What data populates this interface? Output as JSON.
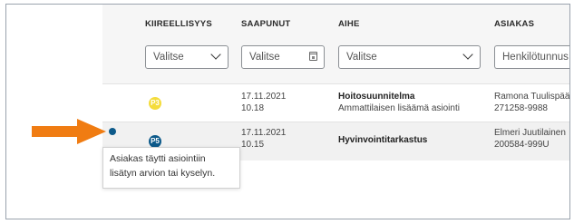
{
  "table": {
    "columns": [
      {
        "key": "urgency",
        "label": "KIIREELLISYYS"
      },
      {
        "key": "arrived",
        "label": "SAAPUNUT"
      },
      {
        "key": "subject",
        "label": "AIHE"
      },
      {
        "key": "customer",
        "label": "ASIAKAS"
      }
    ],
    "filters": {
      "urgency_placeholder": "Valitse",
      "arrived_placeholder": "Valitse",
      "subject_placeholder": "Valitse",
      "customer_placeholder": "Henkilötunnus"
    },
    "rows": [
      {
        "priority": "P3",
        "date": "17.11.2021",
        "time": "10.18",
        "subject_title": "Hoitosuunnitelma",
        "subject_sub": "Ammattilaisen lisäämä asiointi",
        "customer_name": "Ramona Tuulispää",
        "customer_id": "271258-9988"
      },
      {
        "priority": "P5",
        "date": "17.11.2021",
        "time": "10.15",
        "subject_title": "Hyvinvointitarkastus",
        "subject_sub": "",
        "customer_name": "Elmeri Juutilainen",
        "customer_id": "200584-999U"
      }
    ]
  },
  "tooltip": {
    "line1": "Asiakas täytti asiointiin",
    "line2": "lisätyn arvion tai kyselyn."
  },
  "colors": {
    "p3": "#f4dc3c",
    "p5": "#0d5a8a",
    "status_dot": "#0d5a8a",
    "arrow": "#f07c12"
  },
  "icons": {
    "urgency_filter": "chevron-down-icon",
    "arrived_filter": "calendar-icon",
    "subject_filter": "chevron-down-icon",
    "status": "status-dot-icon",
    "pointer": "arrow-right-icon"
  }
}
